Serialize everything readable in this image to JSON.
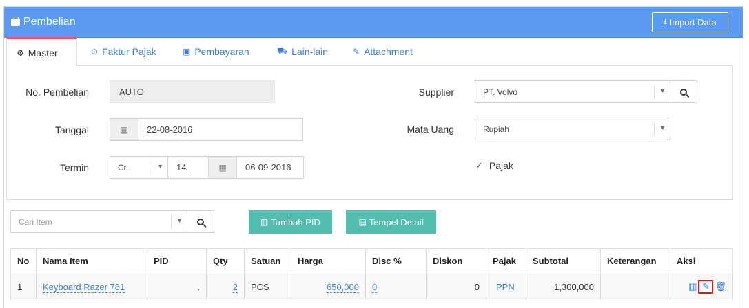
{
  "header": {
    "title": "Pembelian",
    "import_label": "Import Data",
    "accent": "#5b9bf1"
  },
  "tabs": [
    {
      "label": "Master",
      "icon": "gears-icon"
    },
    {
      "label": "Faktur Pajak",
      "icon": "check-circle-icon"
    },
    {
      "label": "Pembayaran",
      "icon": "money-icon"
    },
    {
      "label": "Lain-lain",
      "icon": "truck-icon"
    },
    {
      "label": "Attachment",
      "icon": "paperclip-icon"
    }
  ],
  "form": {
    "no_pembelian_label": "No. Pembelian",
    "no_pembelian_value": "AUTO",
    "tanggal_label": "Tanggal",
    "tanggal_value": "22-08-2016",
    "termin_label": "Termin",
    "termin_type": "Cr...",
    "termin_days": "14",
    "termin_date": "06-09-2016",
    "supplier_label": "Supplier",
    "supplier_value": "PT. Volvo",
    "mata_uang_label": "Mata Uang",
    "mata_uang_value": "Rupiah",
    "pajak_label": "Pajak",
    "pajak_checked": true
  },
  "item_bar": {
    "search_placeholder": "Cari Item",
    "tambah_pid_label": "Tambah PID",
    "tempel_detail_label": "Tempel Detail",
    "button_color": "#53bdb0"
  },
  "table": {
    "headers": [
      "No",
      "Nama Item",
      "PID",
      "Qty",
      "Satuan",
      "Harga",
      "Disc %",
      "Diskon",
      "Pajak",
      "Subtotal",
      "Keterangan",
      "Aksi"
    ],
    "rows": [
      {
        "no": "1",
        "nama_item": "Keyboard Razer 781",
        "pid": ".",
        "qty": "2",
        "satuan": "PCS",
        "harga": "650,000",
        "disc": "0",
        "diskon": "0",
        "pajak": "PPN",
        "subtotal": "1,300,000",
        "keterangan": ""
      }
    ]
  }
}
